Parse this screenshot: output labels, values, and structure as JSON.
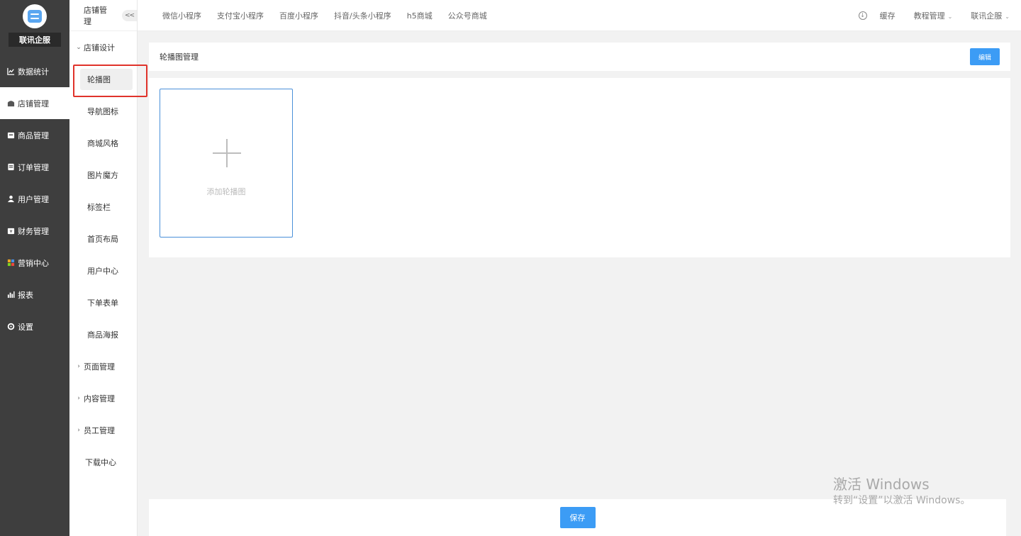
{
  "brand": {
    "name": "联讯企服",
    "logo_icon": "store-logo-icon"
  },
  "sidebar": {
    "items": [
      {
        "label": "数据统计",
        "icon": "line-chart-icon",
        "active": false
      },
      {
        "label": "店铺管理",
        "icon": "shop-icon",
        "active": true
      },
      {
        "label": "商品管理",
        "icon": "box-icon",
        "active": false
      },
      {
        "label": "订单管理",
        "icon": "order-icon",
        "active": false
      },
      {
        "label": "用户管理",
        "icon": "user-icon",
        "active": false
      },
      {
        "label": "财务管理",
        "icon": "finance-icon",
        "active": false
      },
      {
        "label": "营销中心",
        "icon": "marketing-icon",
        "active": false
      },
      {
        "label": "报表",
        "icon": "bar-chart-icon",
        "active": false
      },
      {
        "label": "设置",
        "icon": "gear-icon",
        "active": false
      }
    ]
  },
  "submenu": {
    "header": "店铺管理",
    "collapse": "<<",
    "group_design": "店铺设计",
    "design_items": [
      "轮播图",
      "导航图标",
      "商城风格",
      "图片魔方",
      "标签栏",
      "首页布局",
      "用户中心",
      "下单表单",
      "商品海报"
    ],
    "groups_collapsed": [
      "页面管理",
      "内容管理",
      "员工管理"
    ],
    "download": "下载中心"
  },
  "topbar": {
    "tabs": [
      "微信小程序",
      "支付宝小程序",
      "百度小程序",
      "抖音/头条小程序",
      "h5商城",
      "公众号商城"
    ],
    "cache": "缓存",
    "tutorial": "教程管理",
    "account": "联讯企服"
  },
  "main": {
    "title": "轮播图管理",
    "edit": "编辑",
    "add_banner": "添加轮播图",
    "save": "保存"
  },
  "watermark": {
    "line1": "激活 Windows",
    "line2": "转到“设置”以激活 Windows。"
  },
  "colors": {
    "primary": "#3c9cf5",
    "sidebar_bg": "#3e3e3e",
    "highlight": "#e0332b"
  }
}
